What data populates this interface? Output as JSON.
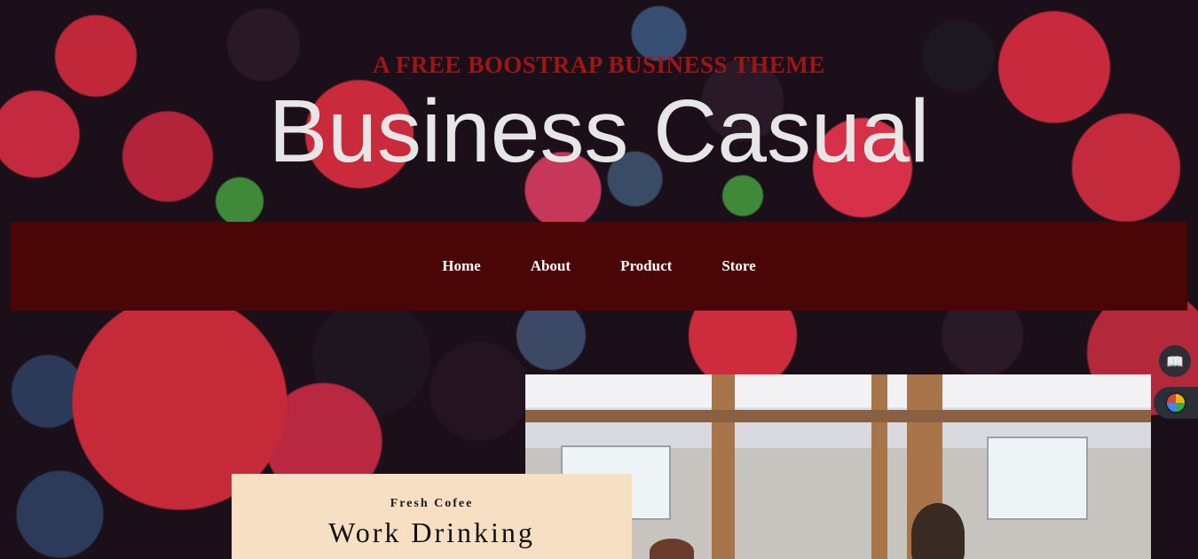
{
  "header": {
    "kicker": "A FREE BOOSTRAP BUSINESS THEME",
    "title": "Business Casual"
  },
  "nav": {
    "items": [
      {
        "label": "Home"
      },
      {
        "label": "About"
      },
      {
        "label": "Product"
      },
      {
        "label": "Store"
      }
    ]
  },
  "intro": {
    "subheading": "Fresh Cofee",
    "heading": "Work Drinking"
  },
  "icons": {
    "reader": "reader-mode-icon",
    "extension": "extension-icon"
  },
  "colors": {
    "nav_bg": "#4a0606",
    "kicker": "#9f1516",
    "card_bg": "#f6dfc2"
  }
}
